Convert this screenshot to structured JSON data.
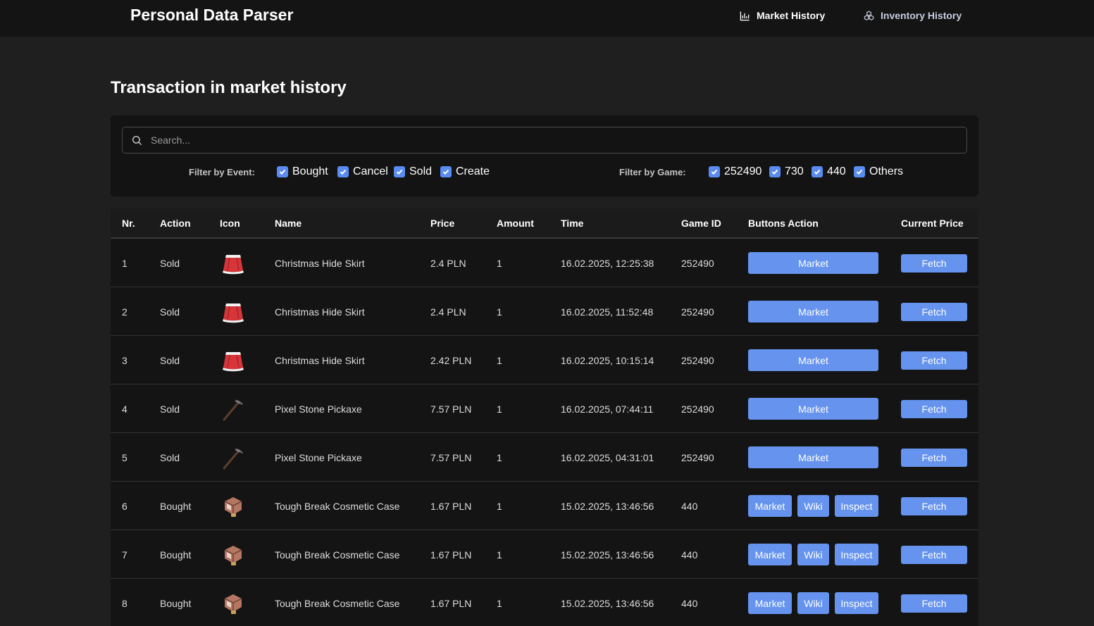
{
  "app": {
    "title": "Personal Data Parser",
    "nav": [
      {
        "label": "Market History",
        "icon": "bar-chart-icon"
      },
      {
        "label": "Inventory History",
        "icon": "cubes-icon"
      }
    ]
  },
  "page": {
    "title": "Transaction in market history"
  },
  "search": {
    "placeholder": "Search..."
  },
  "filters": {
    "event_label": "Filter by Event:",
    "events": [
      {
        "label": "Bought",
        "checked": true
      },
      {
        "label": "Cancel",
        "checked": true
      },
      {
        "label": "Sold",
        "checked": true
      },
      {
        "label": "Create",
        "checked": true
      }
    ],
    "game_label": "Filter by Game:",
    "games": [
      {
        "label": "252490",
        "checked": true
      },
      {
        "label": "730",
        "checked": true
      },
      {
        "label": "440",
        "checked": true
      },
      {
        "label": "Others",
        "checked": true
      }
    ]
  },
  "table": {
    "headers": [
      "Nr.",
      "Action",
      "Icon",
      "Name",
      "Price",
      "Amount",
      "Time",
      "Game ID",
      "Buttons Action",
      "Current Price"
    ],
    "buttons": {
      "market": "Market",
      "wiki": "Wiki",
      "inspect": "Inspect",
      "fetch": "Fetch"
    },
    "rows": [
      {
        "nr": "1",
        "action": "Sold",
        "icon": "skirt-icon",
        "name": "Christmas Hide Skirt",
        "price": "2.4 PLN",
        "amount": "1",
        "time": "16.02.2025, 12:25:38",
        "game_id": "252490",
        "extra_buttons": false
      },
      {
        "nr": "2",
        "action": "Sold",
        "icon": "skirt-icon",
        "name": "Christmas Hide Skirt",
        "price": "2.4 PLN",
        "amount": "1",
        "time": "16.02.2025, 11:52:48",
        "game_id": "252490",
        "extra_buttons": false
      },
      {
        "nr": "3",
        "action": "Sold",
        "icon": "skirt-icon",
        "name": "Christmas Hide Skirt",
        "price": "2.42 PLN",
        "amount": "1",
        "time": "16.02.2025, 10:15:14",
        "game_id": "252490",
        "extra_buttons": false
      },
      {
        "nr": "4",
        "action": "Sold",
        "icon": "pickaxe-icon",
        "name": "Pixel Stone Pickaxe",
        "price": "7.57 PLN",
        "amount": "1",
        "time": "16.02.2025, 07:44:11",
        "game_id": "252490",
        "extra_buttons": false
      },
      {
        "nr": "5",
        "action": "Sold",
        "icon": "pickaxe-icon",
        "name": "Pixel Stone Pickaxe",
        "price": "7.57 PLN",
        "amount": "1",
        "time": "16.02.2025, 04:31:01",
        "game_id": "252490",
        "extra_buttons": false
      },
      {
        "nr": "6",
        "action": "Bought",
        "icon": "crate-icon",
        "name": "Tough Break Cosmetic Case",
        "price": "1.67 PLN",
        "amount": "1",
        "time": "15.02.2025, 13:46:56",
        "game_id": "440",
        "extra_buttons": true
      },
      {
        "nr": "7",
        "action": "Bought",
        "icon": "crate-icon",
        "name": "Tough Break Cosmetic Case",
        "price": "1.67 PLN",
        "amount": "1",
        "time": "15.02.2025, 13:46:56",
        "game_id": "440",
        "extra_buttons": true
      },
      {
        "nr": "8",
        "action": "Bought",
        "icon": "crate-icon",
        "name": "Tough Break Cosmetic Case",
        "price": "1.67 PLN",
        "amount": "1",
        "time": "15.02.2025, 13:46:56",
        "game_id": "440",
        "extra_buttons": true
      }
    ]
  },
  "colors": {
    "background": "#1f1f1f",
    "navbar": "#141414",
    "card": "#131313",
    "accent": "#6593ee",
    "checkbox": "#5a8cf0"
  }
}
